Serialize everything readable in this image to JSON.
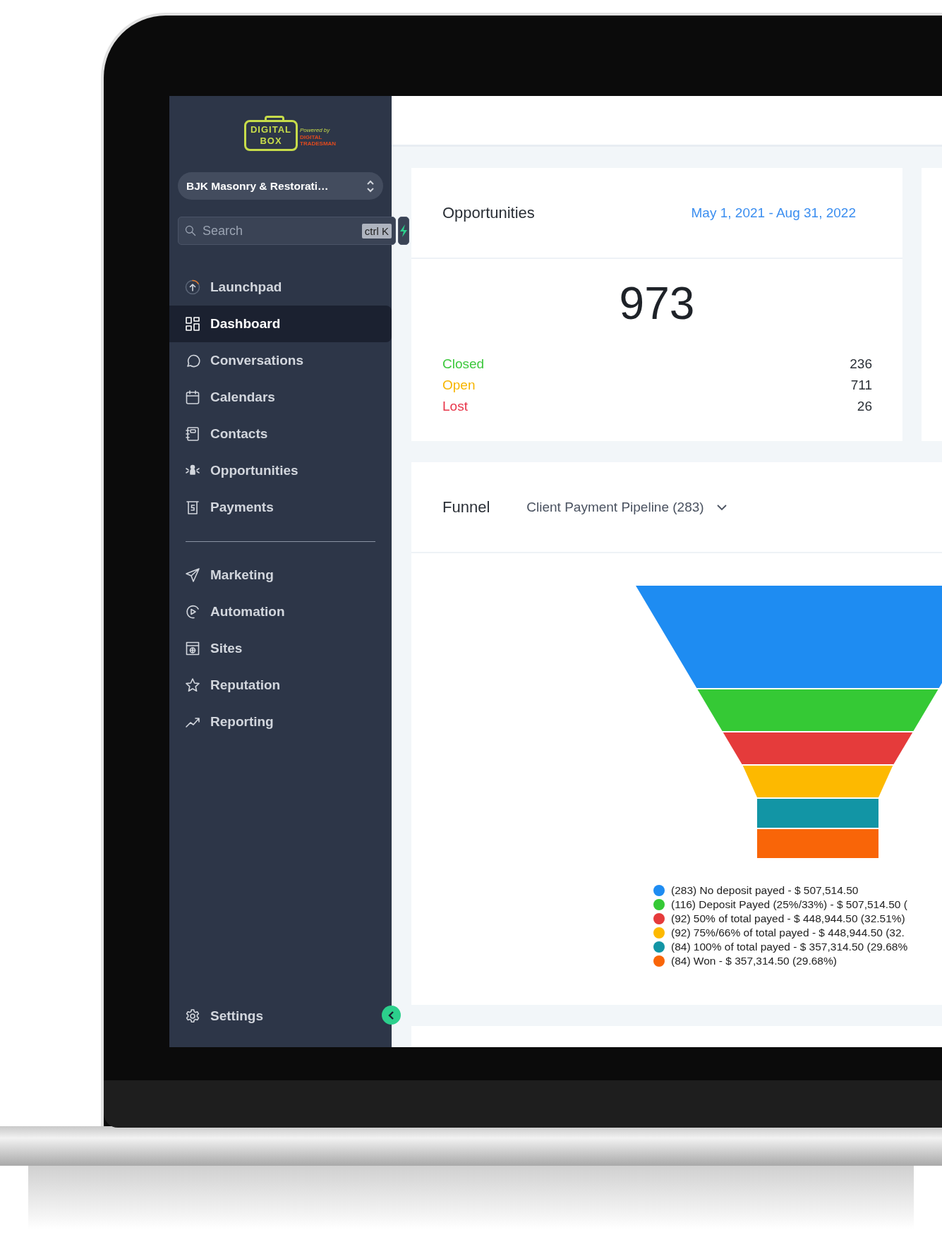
{
  "sidebar": {
    "logo": {
      "title": "DIGITAL",
      "subtitle": "BOX",
      "powered_by": "Powered by",
      "partner": "DIGITAL TRADESMAN"
    },
    "account": "BJK Masonry & Restorati…",
    "search": {
      "placeholder": "Search",
      "shortcut": "ctrl K"
    },
    "nav": [
      {
        "label": "Launchpad",
        "selected": false
      },
      {
        "label": "Dashboard",
        "selected": true
      },
      {
        "label": "Conversations",
        "selected": false
      },
      {
        "label": "Calendars",
        "selected": false
      },
      {
        "label": "Contacts",
        "selected": false
      },
      {
        "label": "Opportunities",
        "selected": false
      },
      {
        "label": "Payments",
        "selected": false
      }
    ],
    "nav_secondary": [
      {
        "label": "Marketing",
        "selected": false
      },
      {
        "label": "Automation",
        "selected": false
      },
      {
        "label": "Sites",
        "selected": false
      },
      {
        "label": "Reputation",
        "selected": false
      },
      {
        "label": "Reporting",
        "selected": false
      }
    ],
    "settings": "Settings"
  },
  "opportunities": {
    "title": "Opportunities",
    "date_range": "May 1, 2021 - Aug 31, 2022",
    "total": "973",
    "statuses": [
      {
        "label": "Closed",
        "value": "236",
        "color": "#3cc83c"
      },
      {
        "label": "Open",
        "value": "711",
        "color": "#f7b500"
      },
      {
        "label": "Lost",
        "value": "26",
        "color": "#e8364a"
      }
    ]
  },
  "funnel": {
    "title": "Funnel",
    "pipeline": "Client Payment Pipeline (283)",
    "stages": [
      {
        "label": "(283) No deposit payed - $ 507,514.50",
        "color": "#1e8cf2"
      },
      {
        "label": "(116) Deposit Payed (25%/33%) - $ 507,514.50 (",
        "color": "#35c935"
      },
      {
        "label": "(92) 50% of total payed - $ 448,944.50 (32.51%)",
        "color": "#e53b3b"
      },
      {
        "label": "(92) 75%/66% of total payed - $ 448,944.50 (32.",
        "color": "#fdb900"
      },
      {
        "label": "(84) 100% of total payed - $ 357,314.50 (29.68%",
        "color": "#1295a5"
      },
      {
        "label": "(84) Won - $ 357,314.50 (29.68%)",
        "color": "#f96508"
      }
    ]
  }
}
